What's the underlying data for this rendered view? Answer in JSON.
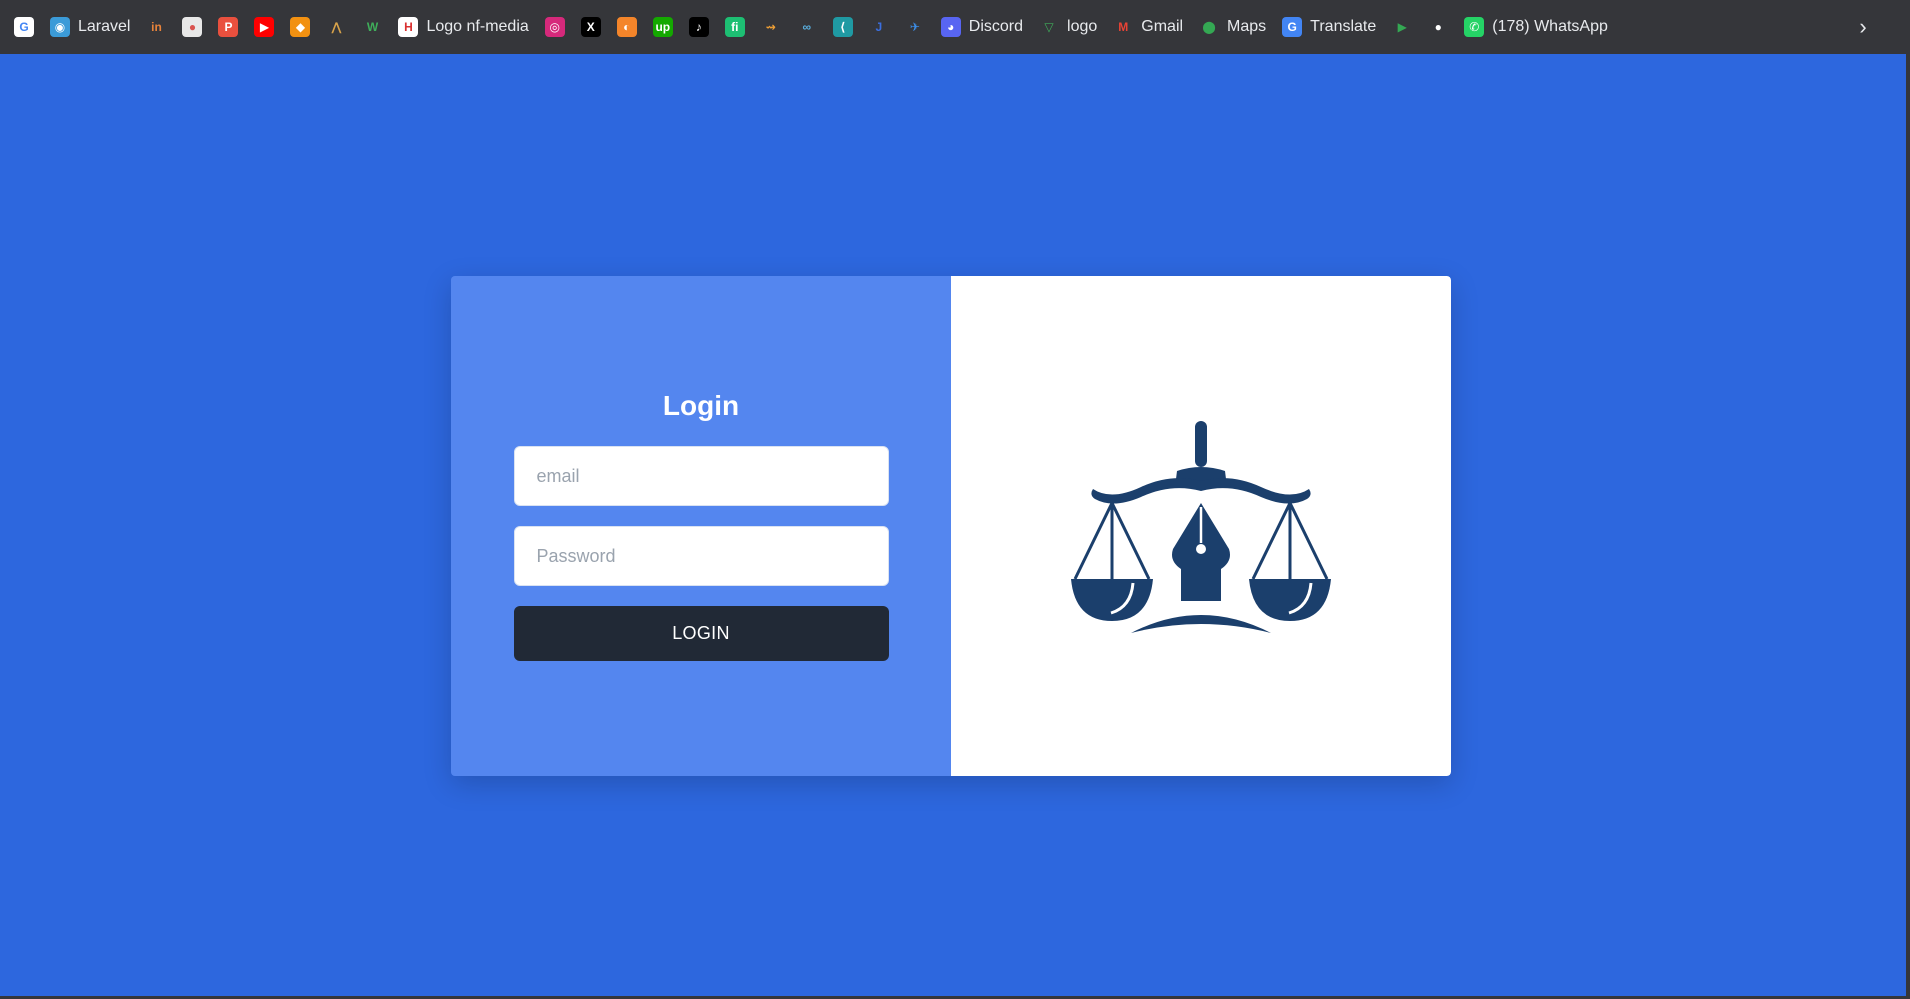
{
  "bookmarks": [
    {
      "name": "google-icon",
      "label": "",
      "color": "#ffffff",
      "glyph": "G",
      "glyphColor": "#4285f4"
    },
    {
      "name": "laravel-bookmark",
      "label": "Laravel",
      "color": "#3b9bd8",
      "glyph": "◉"
    },
    {
      "name": "invision-bookmark",
      "label": "",
      "color": "transparent",
      "glyph": "in",
      "glyphColor": "#e8833a"
    },
    {
      "name": "bookmark-3",
      "label": "",
      "color": "#e8e8e8",
      "glyph": "●",
      "glyphColor": "#d9534f"
    },
    {
      "name": "bookmark-4",
      "label": "",
      "color": "#e9503e",
      "glyph": "P"
    },
    {
      "name": "youtube-bookmark",
      "label": "",
      "color": "#ff0000",
      "glyph": "▶"
    },
    {
      "name": "bookmark-6",
      "label": "",
      "color": "#f29111",
      "glyph": "◆"
    },
    {
      "name": "bookmark-7",
      "label": "",
      "color": "transparent",
      "glyph": "⋀",
      "glyphColor": "#d8a34a"
    },
    {
      "name": "bookmark-8",
      "label": "",
      "color": "transparent",
      "glyph": "W",
      "glyphColor": "#3fae5a"
    },
    {
      "name": "logo-nf-media-bookmark",
      "label": "Logo nf-media",
      "color": "#ffffff",
      "glyph": "H",
      "glyphColor": "#d93030"
    },
    {
      "name": "instagram-bookmark",
      "label": "",
      "color": "#d6297b",
      "glyph": "◎"
    },
    {
      "name": "x-bookmark",
      "label": "",
      "color": "#000000",
      "glyph": "X"
    },
    {
      "name": "bookmark-12",
      "label": "",
      "color": "#f4852a",
      "glyph": "◐"
    },
    {
      "name": "upwork-bookmark",
      "label": "",
      "color": "#14a800",
      "glyph": "up"
    },
    {
      "name": "tiktok-bookmark",
      "label": "",
      "color": "#000000",
      "glyph": "♪"
    },
    {
      "name": "fiverr-bookmark",
      "label": "",
      "color": "#1dbf73",
      "glyph": "fi"
    },
    {
      "name": "bookmark-16",
      "label": "",
      "color": "transparent",
      "glyph": "⇝",
      "glyphColor": "#f0a035"
    },
    {
      "name": "bookmark-17",
      "label": "",
      "color": "transparent",
      "glyph": "∞",
      "glyphColor": "#5ab0e0"
    },
    {
      "name": "bookmark-18",
      "label": "",
      "color": "#1f9aa3",
      "glyph": "⟨"
    },
    {
      "name": "bookmark-19",
      "label": "",
      "color": "transparent",
      "glyph": "J",
      "glyphColor": "#3b6fe0"
    },
    {
      "name": "bookmark-20",
      "label": "",
      "color": "transparent",
      "glyph": "✈",
      "glyphColor": "#3c8ee8"
    },
    {
      "name": "discord-bookmark",
      "label": "Discord",
      "color": "#5865f2",
      "glyph": "◕"
    },
    {
      "name": "logo-bookmark",
      "label": "logo",
      "color": "transparent",
      "glyph": "▽",
      "glyphColor": "#3fae5a"
    },
    {
      "name": "gmail-bookmark",
      "label": "Gmail",
      "color": "transparent",
      "glyph": "M",
      "glyphColor": "#ea4335"
    },
    {
      "name": "maps-bookmark",
      "label": "Maps",
      "color": "transparent",
      "glyph": "⬤",
      "glyphColor": "#34a853"
    },
    {
      "name": "translate-bookmark",
      "label": "Translate",
      "color": "#4285f4",
      "glyph": "G"
    },
    {
      "name": "play-bookmark",
      "label": "",
      "color": "transparent",
      "glyph": "▶",
      "glyphColor": "#34a853"
    },
    {
      "name": "github-bookmark",
      "label": "",
      "color": "transparent",
      "glyph": "●",
      "glyphColor": "#ffffff"
    },
    {
      "name": "whatsapp-bookmark",
      "label": "(178) WhatsApp",
      "color": "#25d366",
      "glyph": "✆"
    }
  ],
  "bookmarks_more_glyph": "›",
  "login": {
    "title": "Login",
    "email_placeholder": "email",
    "password_placeholder": "Password",
    "button_label": "LOGIN"
  },
  "colors": {
    "page_background": "#2d67de",
    "left_panel": "#5486ef",
    "button": "#212936",
    "logo": "#1b3f6c"
  },
  "logo_icon": "scales-of-justice-pen-nib-icon"
}
